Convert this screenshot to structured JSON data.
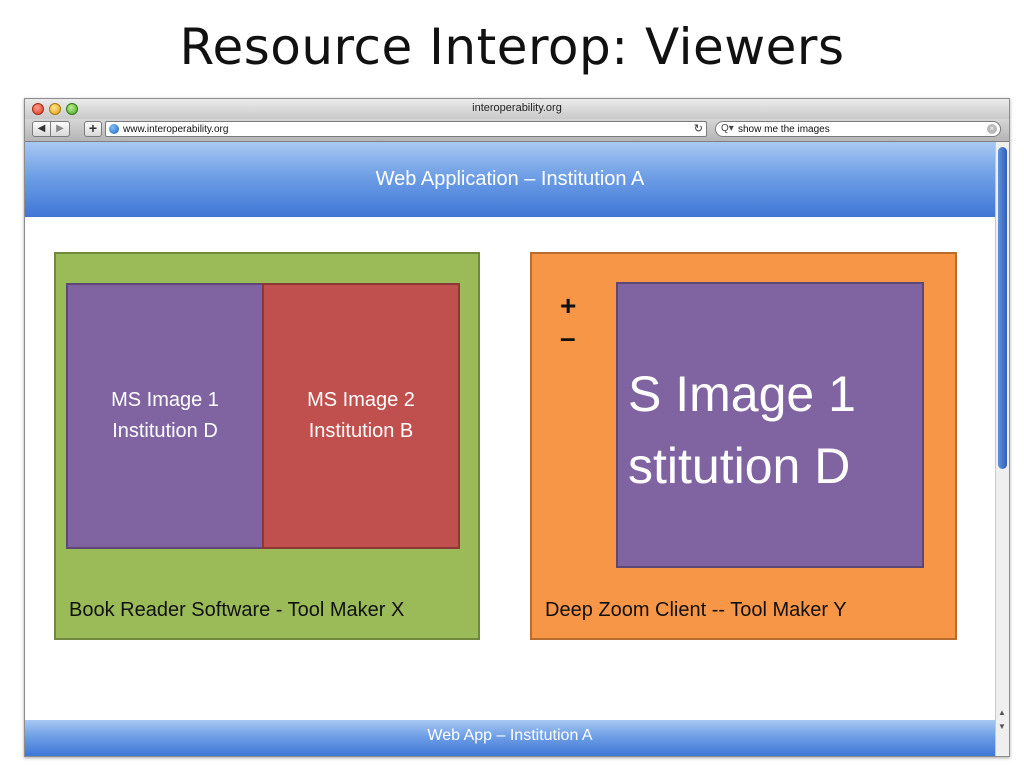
{
  "slide": {
    "title": "Resource Interop: Viewers"
  },
  "browser": {
    "window_title": "interoperability.org",
    "url": "www.interoperability.org",
    "search_query": "show me the images"
  },
  "app": {
    "header": "Web Application – Institution A",
    "footer": "Web App – Institution A"
  },
  "book_reader": {
    "caption": "Book Reader Software - Tool Maker X",
    "images": [
      {
        "line1": "MS Image 1",
        "line2": "Institution D"
      },
      {
        "line1": "MS Image 2",
        "line2": "Institution B"
      }
    ]
  },
  "deep_zoom": {
    "caption": "Deep Zoom Client -- Tool Maker Y",
    "zoom_in": "+",
    "zoom_out": "–",
    "visible_line1": "S Image 1",
    "visible_line2": "stitution D"
  },
  "colors": {
    "header_blue": "#4f86db",
    "green_panel": "#9bbb59",
    "orange_panel": "#f79646",
    "purple_tile": "#8064a2",
    "red_tile": "#c0504d"
  },
  "icons": [
    "close-icon",
    "minimize-icon",
    "maximize-icon",
    "back-icon",
    "forward-icon",
    "add-icon",
    "globe-icon",
    "reload-icon",
    "search-icon",
    "clear-icon"
  ]
}
